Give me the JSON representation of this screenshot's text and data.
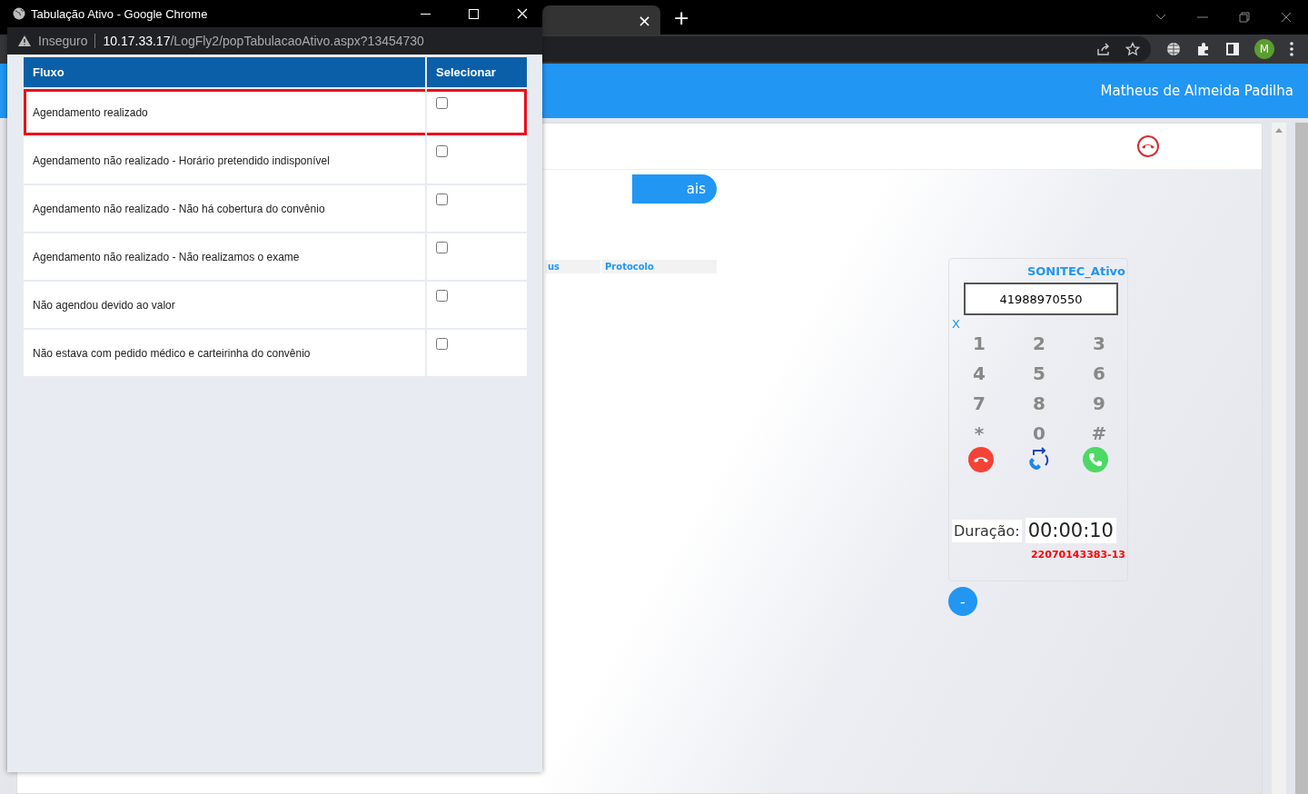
{
  "browser": {
    "tab_close": "×",
    "new_tab": "+",
    "avatar": "M"
  },
  "header": {
    "user": "Matheus de Almeida Padilha"
  },
  "page": {
    "button_fragment": "ais",
    "table_columns": [
      "us",
      "Protocolo"
    ]
  },
  "dialer": {
    "account": "SONITEC_Ativo",
    "number": "41988970550",
    "clear": "X",
    "keys": [
      "1",
      "2",
      "3",
      "4",
      "5",
      "6",
      "7",
      "8",
      "9",
      "*",
      "0",
      "#"
    ],
    "duration_label": "Duração:",
    "duration": "00:00:10",
    "call_id": "22070143383-13",
    "minimize": "-"
  },
  "popup": {
    "title": "Tabulação Ativo - Google Chrome",
    "security": "Inseguro",
    "url_host": "10.17.33.17",
    "url_path": "/LogFly2/popTabulacaoAtivo.aspx?13454730",
    "columns": [
      "Fluxo",
      "Selecionar"
    ],
    "rows": [
      {
        "label": "Agendamento realizado",
        "checked": false,
        "highlighted": true
      },
      {
        "label": "Agendamento não realizado - Horário pretendido indisponível",
        "checked": false,
        "highlighted": false
      },
      {
        "label": "Agendamento não realizado - Não há cobertura do convênio",
        "checked": false,
        "highlighted": false
      },
      {
        "label": "Agendamento não realizado - Não realizamos o exame",
        "checked": false,
        "highlighted": false
      },
      {
        "label": "Não agendou devido ao valor",
        "checked": false,
        "highlighted": false
      },
      {
        "label": "Não estava com pedido médico e carteirinha do convênio",
        "checked": false,
        "highlighted": false
      }
    ]
  }
}
